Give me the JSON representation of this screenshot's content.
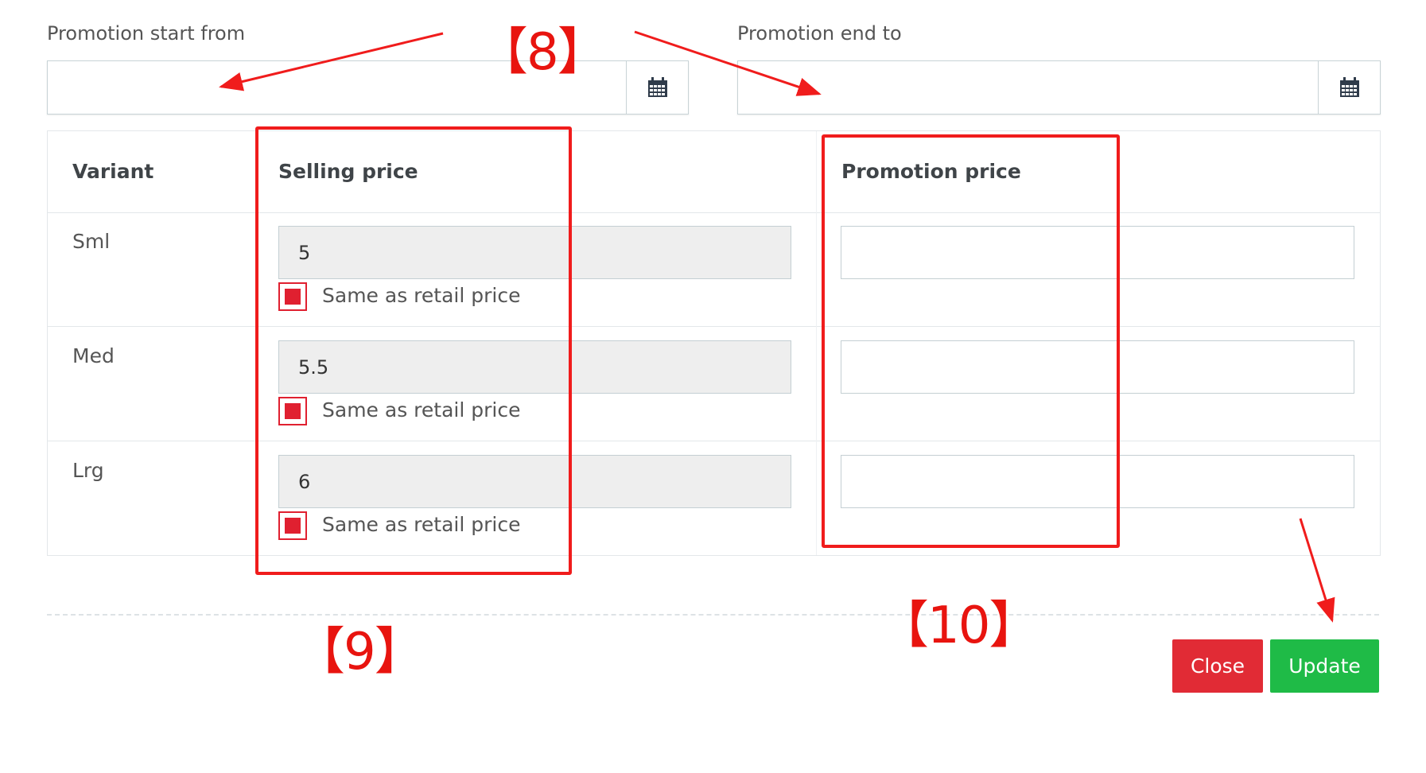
{
  "dates": {
    "start_label": "Promotion start from",
    "start_value": "",
    "end_label": "Promotion end to",
    "end_value": ""
  },
  "table": {
    "headers": {
      "variant": "Variant",
      "selling": "Selling price",
      "promotion": "Promotion price"
    },
    "rows": [
      {
        "variant": "Sml",
        "selling_price": "5",
        "same_as_retail_label": "Same as retail price",
        "same_as_retail_checked": true,
        "promotion_price": ""
      },
      {
        "variant": "Med",
        "selling_price": "5.5",
        "same_as_retail_label": "Same as retail price",
        "same_as_retail_checked": true,
        "promotion_price": ""
      },
      {
        "variant": "Lrg",
        "selling_price": "6",
        "same_as_retail_label": "Same as retail price",
        "same_as_retail_checked": true,
        "promotion_price": ""
      }
    ]
  },
  "buttons": {
    "close": "Close",
    "update": "Update"
  },
  "annotations": {
    "n8": "【8】",
    "n9": "【9】",
    "n10": "【10】"
  },
  "icons": {
    "calendar": "calendar-icon"
  },
  "colors": {
    "annotation": "#f01c1c",
    "close_button": "#e12b35",
    "update_button": "#1fbb47",
    "checkbox": "#e02030",
    "readonly_input": "#eeeeee"
  }
}
